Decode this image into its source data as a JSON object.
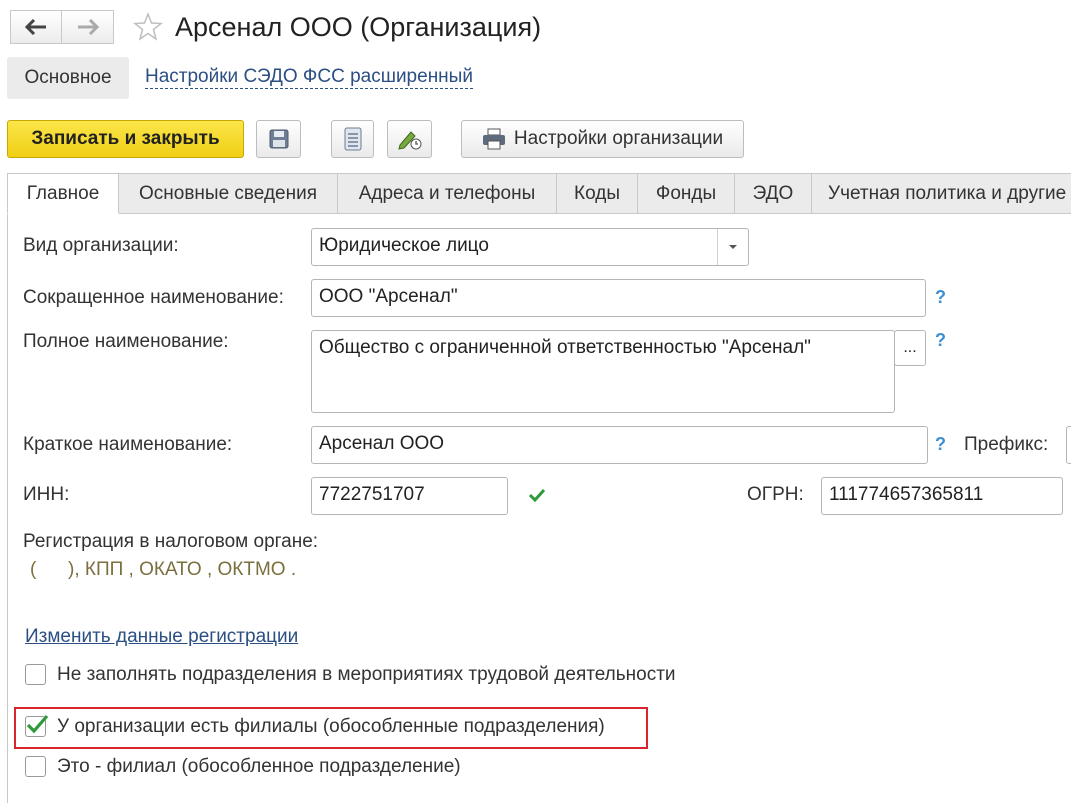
{
  "window": {
    "title": "Арсенал ООО (Организация)"
  },
  "nav": {
    "back": "back-arrow-icon",
    "forward": "forward-arrow-icon",
    "favorite": "star-icon"
  },
  "subnav": {
    "main_label": "Основное",
    "link_label": "Настройки СЭДО ФСС расширенный"
  },
  "toolbar": {
    "save_close_label": "Записать и закрыть",
    "settings_label": "Настройки организации",
    "icons": [
      "save-icon",
      "list-icon",
      "edit-history-icon",
      "printer-icon"
    ]
  },
  "tabs": [
    {
      "label": "Главное",
      "active": true
    },
    {
      "label": "Основные сведения"
    },
    {
      "label": "Адреса и телефоны"
    },
    {
      "label": "Коды"
    },
    {
      "label": "Фонды"
    },
    {
      "label": "ЭДО"
    },
    {
      "label": "Учетная политика и другие"
    }
  ],
  "form": {
    "kind_label": "Вид организации:",
    "kind_value": "Юридическое лицо",
    "short_name_label": "Сокращенное наименование:",
    "short_name_value": "ООО \"Арсенал\"",
    "full_name_label": "Полное наименование:",
    "full_name_value": "Общество с ограниченной ответственностью \"Арсенал\"",
    "full_name_btn": "...",
    "brief_name_label": "Краткое наименование:",
    "brief_name_value": "Арсенал ООО",
    "prefix_label": "Префикс:",
    "inn_label": "ИНН:",
    "inn_value": "7722751707",
    "ogrn_label": "ОГРН:",
    "ogrn_value": "111774657365811",
    "help_mark": "?",
    "reg_label": "Регистрация в налоговом органе:",
    "reg_value": "(      ), КПП , ОКАТО , ОКТМО .",
    "reg_link": "Изменить данные регистрации"
  },
  "checkboxes": [
    {
      "label": "Не заполнять подразделения в мероприятиях трудовой деятельности",
      "checked": false
    },
    {
      "label": "У организации есть филиалы (обособленные подразделения)",
      "checked": true,
      "highlighted": true
    },
    {
      "label": "Это - филиал (обособленное подразделение)",
      "checked": false
    }
  ],
  "colors": {
    "primary_button": "#f5d82a",
    "link": "#2b4f82",
    "highlight_frame": "#d7262e",
    "check": "#2e9a3a"
  }
}
